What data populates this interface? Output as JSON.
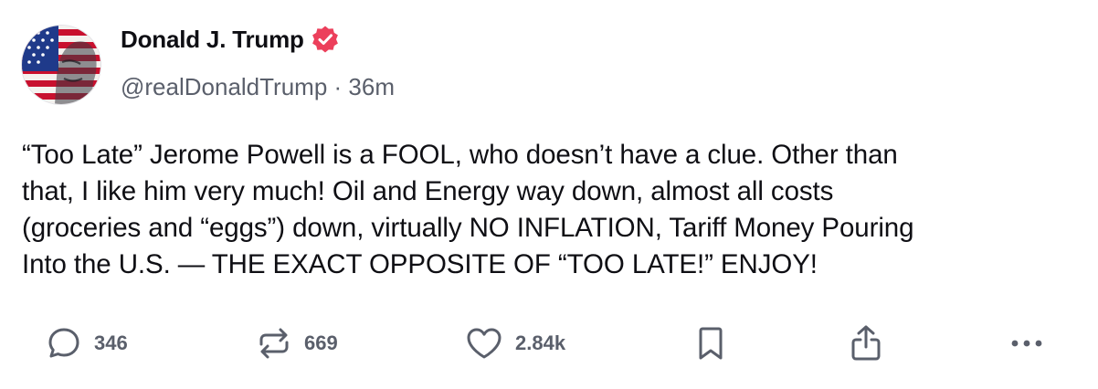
{
  "author": {
    "display_name": "Donald J. Trump",
    "handle": "@realDonaldTrump",
    "separator": " · ",
    "timestamp": "36m",
    "verified": true,
    "avatar_icon": "flag-portrait-avatar"
  },
  "post": {
    "lines": [
      "“Too Late” Jerome Powell is a FOOL, who doesn’t have a clue. Other than",
      "that, I like him very much! Oil and Energy way down, almost all costs",
      "(groceries and “eggs”) down, virtually NO INFLATION, Tariff Money Pouring",
      "Into the U.S. — THE EXACT OPPOSITE OF “TOO LATE!” ENJOY!"
    ]
  },
  "actions": {
    "reply": {
      "icon": "reply-icon",
      "count": "346"
    },
    "repost": {
      "icon": "repost-icon",
      "count": "669"
    },
    "like": {
      "icon": "heart-icon",
      "count": "2.84k"
    },
    "bookmark": {
      "icon": "bookmark-icon"
    },
    "share": {
      "icon": "share-icon"
    },
    "more": {
      "icon": "more-icon"
    }
  },
  "colors": {
    "text": "#0f0f14",
    "muted": "#5a5f6b",
    "verified_badge": "#ec3f5b",
    "background": "#ffffff"
  }
}
